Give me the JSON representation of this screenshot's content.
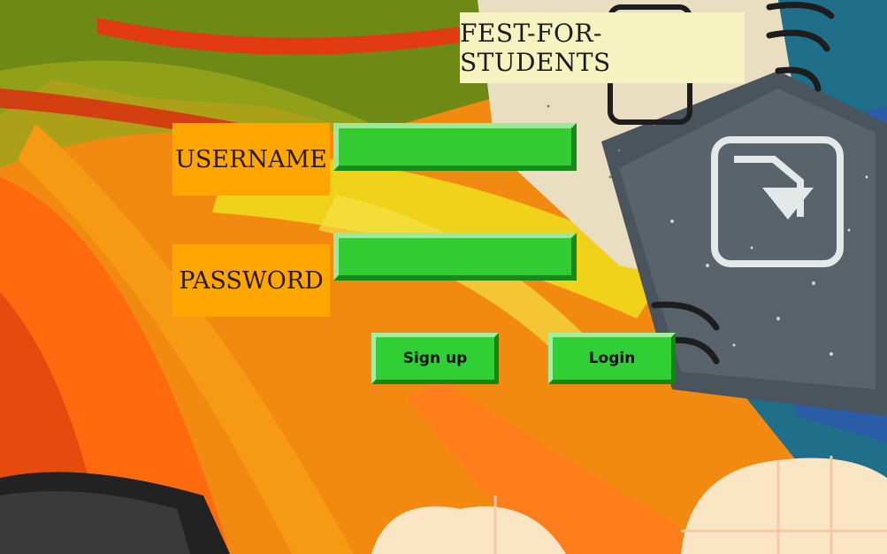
{
  "app": {
    "title": "FEST-FOR-STUDENTS"
  },
  "form": {
    "username_label": "USERNAME",
    "username_value": "",
    "password_label": "PASSWORD",
    "password_value": ""
  },
  "buttons": {
    "signup_label": "Sign up",
    "login_label": "Login"
  },
  "colors": {
    "background": "#f28a12",
    "label_bg": "#ffa600",
    "field_green": "#33cc33",
    "title_bg": "#f7f3c0"
  },
  "icons": {
    "background": "notebook-illustration",
    "document": "download-document-icon"
  }
}
